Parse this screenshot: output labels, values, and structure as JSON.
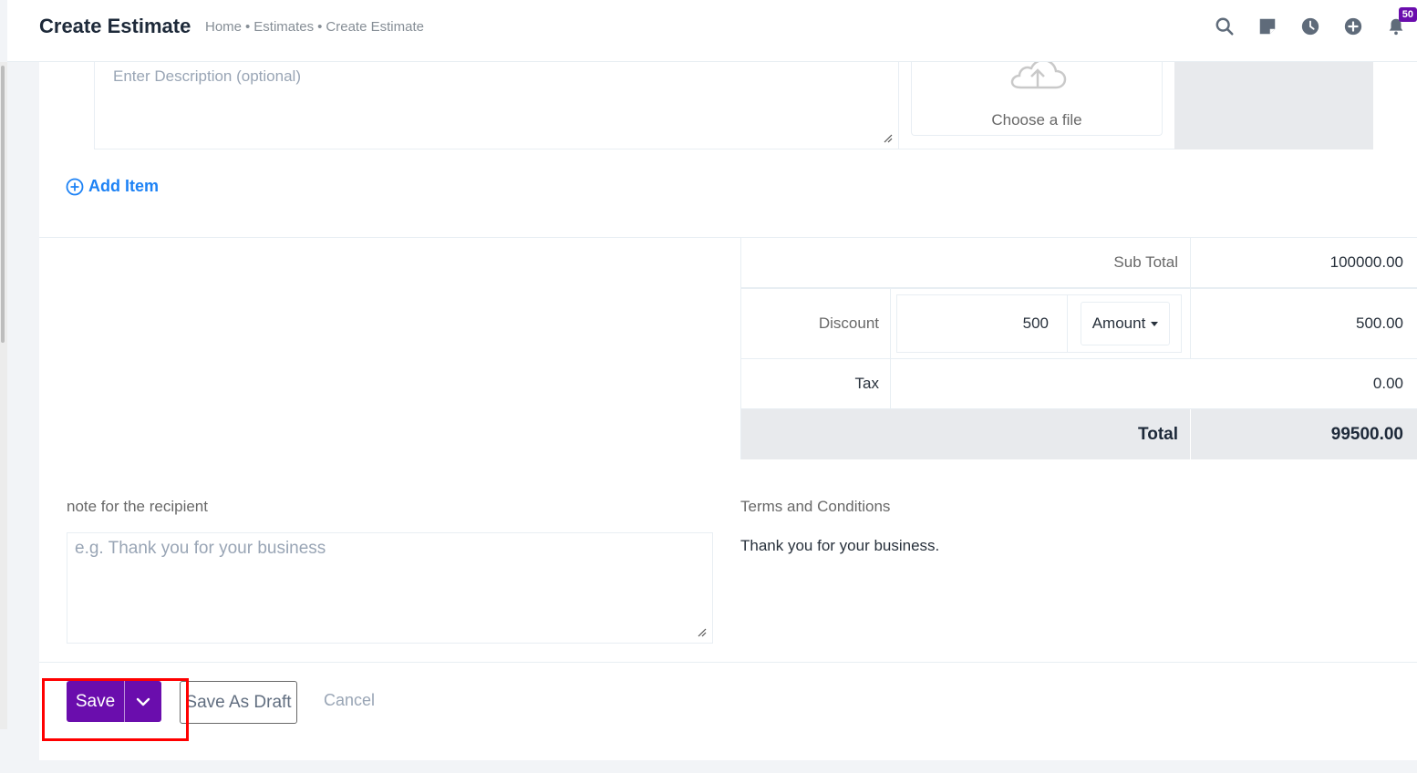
{
  "header": {
    "title": "Create Estimate",
    "breadcrumb": [
      "Home",
      "Estimates",
      "Create Estimate"
    ],
    "breadcrumb_separator": "•",
    "icons": [
      "search-icon",
      "sticky-note-icon",
      "clock-icon",
      "plus-circle-icon",
      "bell-icon"
    ],
    "notification_count": "50"
  },
  "item": {
    "description_placeholder": "Enter Description (optional)",
    "file_upload_label": "Choose a file",
    "file_upload_icon": "cloud-upload-icon"
  },
  "add_item_label": "Add Item",
  "totals": {
    "subtotal_label": "Sub Total",
    "subtotal_value": "100000.00",
    "discount_label": "Discount",
    "discount_input": "500",
    "discount_type": "Amount",
    "discount_value": "500.00",
    "tax_label": "Tax",
    "tax_value": "0.00",
    "total_label": "Total",
    "total_value": "99500.00"
  },
  "note": {
    "label": "note for the recipient",
    "placeholder": "e.g. Thank you for your business"
  },
  "terms": {
    "label": "Terms and Conditions",
    "text": "Thank you for your business."
  },
  "actions": {
    "save_label": "Save",
    "save_as_draft_label": "Save As Draft",
    "cancel_label": "Cancel"
  },
  "colors": {
    "primary": "#6a0dad",
    "link": "#1d82f5",
    "highlight": "#ff0000",
    "total_row_bg": "#e8eaed"
  }
}
